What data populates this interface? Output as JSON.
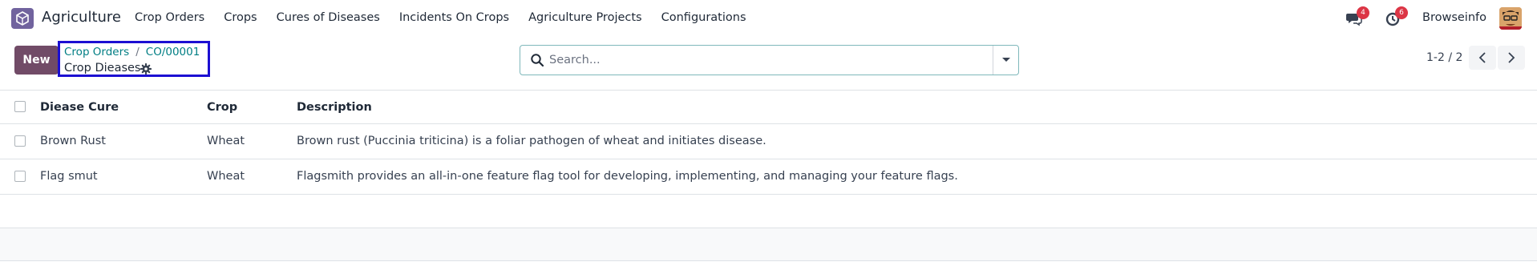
{
  "app": {
    "name": "Agriculture",
    "logo_icon": "odoo-app-icon",
    "accent": "#714b67"
  },
  "nav": {
    "items": [
      "Crop Orders",
      "Crops",
      "Cures of Diseases",
      "Incidents On Crops",
      "Agriculture Projects",
      "Configurations"
    ]
  },
  "systray": {
    "messages_badge": "4",
    "activities_badge": "6",
    "user_name": "Browseinfo"
  },
  "control": {
    "new_label": "New",
    "breadcrumb": [
      "Crop Orders",
      "CO/00001"
    ],
    "breadcrumb_separator": "/",
    "current": "Crop Dieases",
    "search_placeholder": "Search...",
    "pager": "1-2 / 2"
  },
  "table": {
    "columns": [
      "Diease Cure",
      "Crop",
      "Description"
    ],
    "rows": [
      [
        "Brown Rust",
        "Wheat",
        "Brown rust (Puccinia triticina) is a foliar pathogen of wheat and initiates disease."
      ],
      [
        "Flag smut",
        "Wheat",
        "Flagsmith provides an all-in-one feature flag tool for developing, implementing, and managing your feature flags."
      ]
    ]
  }
}
